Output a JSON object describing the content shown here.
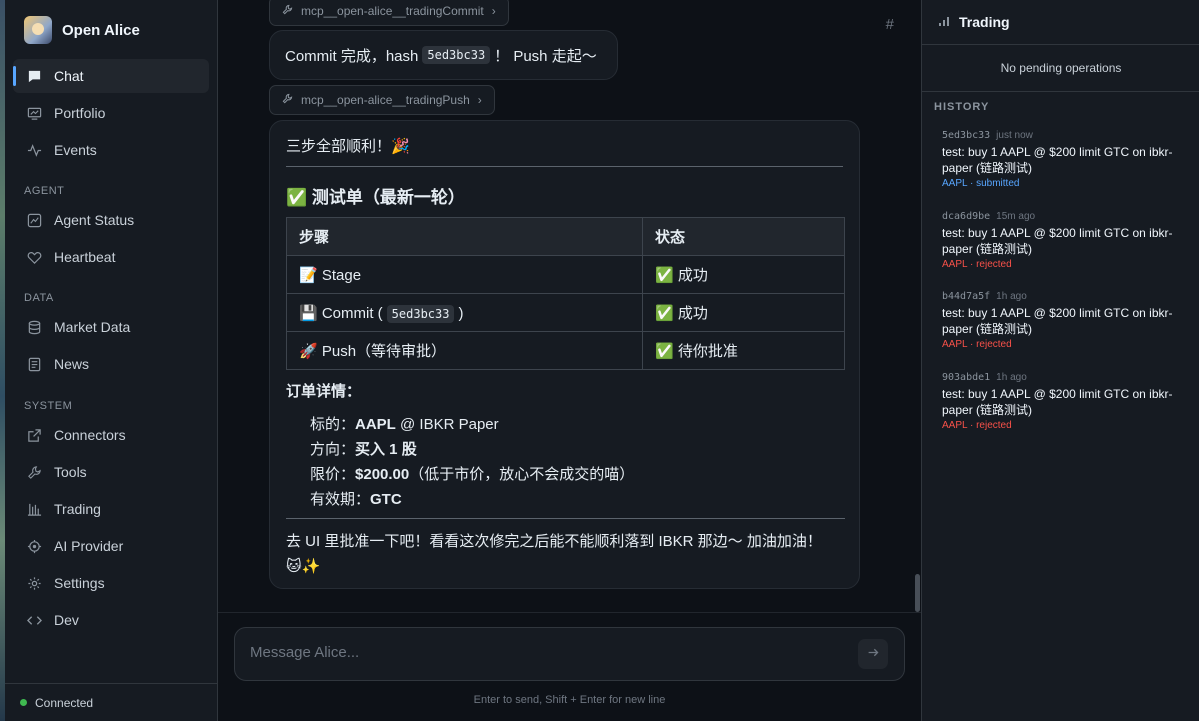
{
  "sidebar": {
    "brand": "Open Alice",
    "nav": [
      {
        "label": "Chat",
        "icon": "chat-icon",
        "active": true
      },
      {
        "label": "Portfolio",
        "icon": "portfolio-icon"
      },
      {
        "label": "Events",
        "icon": "pulse-icon"
      }
    ],
    "section_agent": "AGENT",
    "agent_items": [
      {
        "label": "Agent Status",
        "icon": "chart-icon"
      },
      {
        "label": "Heartbeat",
        "icon": "heart-icon"
      }
    ],
    "section_data": "DATA",
    "data_items": [
      {
        "label": "Market Data",
        "icon": "database-icon"
      },
      {
        "label": "News",
        "icon": "news-icon"
      }
    ],
    "section_system": "SYSTEM",
    "system_items": [
      {
        "label": "Connectors",
        "icon": "external-link-icon"
      },
      {
        "label": "Tools",
        "icon": "wrench-icon"
      },
      {
        "label": "Trading",
        "icon": "trading-icon"
      },
      {
        "label": "AI Provider",
        "icon": "ai-icon"
      },
      {
        "label": "Settings",
        "icon": "gear-icon"
      },
      {
        "label": "Dev",
        "icon": "code-icon"
      }
    ],
    "status": "Connected"
  },
  "chat": {
    "tool_chip_1": "mcp__open-alice__tradingCommit",
    "msg1_prefix": "Commit 完成，hash",
    "msg1_hash": "5ed3bc33",
    "msg1_suffix": "！ Push 走起～",
    "tool_chip_2": "mcp__open-alice__tradingPush",
    "msg2": {
      "intro": "三步全部顺利！🎉",
      "heading": "✅ 测试单（最新一轮）",
      "table_headers": [
        "步骤",
        "状态"
      ],
      "rows": [
        {
          "step": "📝 Stage",
          "status": "✅ 成功"
        },
        {
          "step_prefix": "💾 Commit (",
          "step_code": "5ed3bc33",
          "step_suffix": ")",
          "status": "✅ 成功"
        },
        {
          "step": "🚀 Push（等待审批）",
          "status": "✅ 待你批准"
        }
      ],
      "details_title": "订单详情：",
      "details": [
        {
          "label": "标的：",
          "value": "AAPL",
          "rest": " @ IBKR Paper"
        },
        {
          "label": "方向：",
          "value": "买入 1 股",
          "rest": ""
        },
        {
          "label": "限价：",
          "value": "$200.00",
          "rest": "（低于市价，放心不会成交的喵）"
        },
        {
          "label": "有效期：",
          "value": "GTC",
          "rest": ""
        }
      ],
      "closing_line1": "去 UI 里批准一下吧！看看这次修完之后能不能顺利落到 IBKR 那边～ 加油加油！",
      "closing_line2": "🐱✨"
    },
    "input_placeholder": "Message Alice...",
    "hint": "Enter to send, Shift + Enter for new line"
  },
  "trading_panel": {
    "title": "Trading",
    "pending": "No pending operations",
    "history_label": "HISTORY",
    "history": [
      {
        "hash": "5ed3bc33",
        "time": "just now",
        "text": "test: buy 1 AAPL @ $200 limit GTC on ibkr-paper (链路测试)",
        "status": "AAPL · submitted",
        "status_color": "#58a6ff"
      },
      {
        "hash": "dca6d9be",
        "time": "15m ago",
        "text": "test: buy 1 AAPL @ $200 limit GTC on ibkr-paper (链路测试)",
        "status": "AAPL · rejected",
        "status_color": "#f85149"
      },
      {
        "hash": "b44d7a5f",
        "time": "1h ago",
        "text": "test: buy 1 AAPL @ $200 limit GTC on ibkr-paper (链路测试)",
        "status": "AAPL · rejected",
        "status_color": "#f85149"
      },
      {
        "hash": "903abde1",
        "time": "1h ago",
        "text": "test: buy 1 AAPL @ $200 limit GTC on ibkr-paper (链路测试)",
        "status": "AAPL · rejected",
        "status_color": "#f85149"
      }
    ]
  }
}
